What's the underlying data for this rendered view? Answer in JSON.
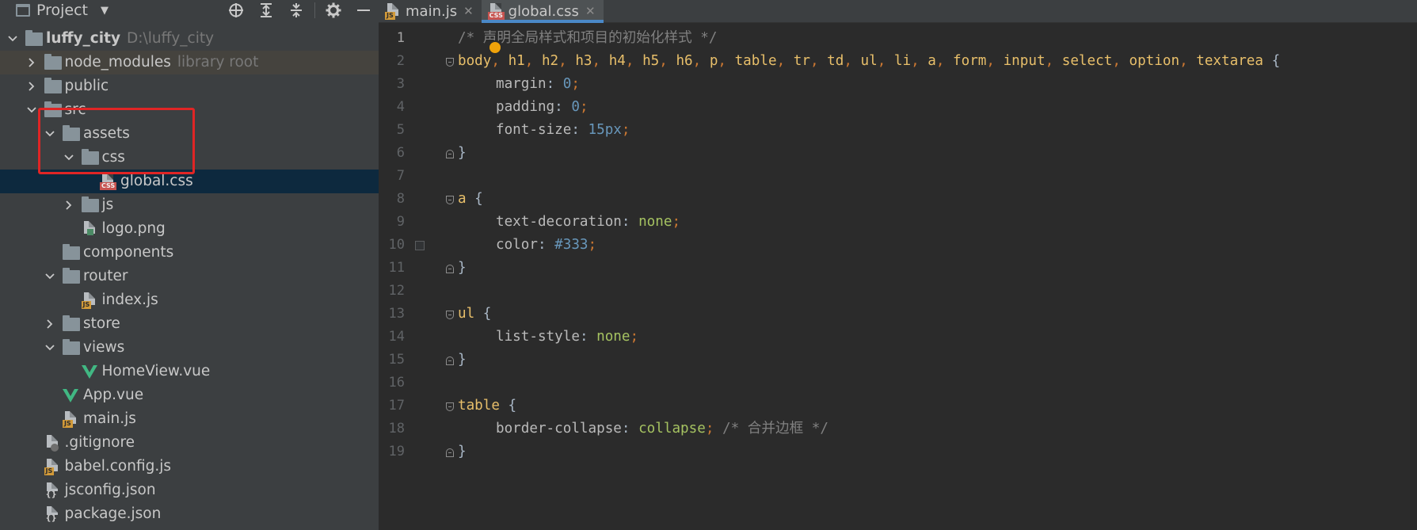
{
  "project": {
    "title": "Project",
    "tree": [
      {
        "label": "luffy_city",
        "hint": "D:\\luffy_city",
        "type": "folder",
        "depth": 0,
        "expanded": true,
        "bold": true
      },
      {
        "label": "node_modules",
        "hint": "library root",
        "type": "folder",
        "depth": 1,
        "expanded": false
      },
      {
        "label": "public",
        "type": "folder",
        "depth": 1,
        "expanded": false
      },
      {
        "label": "src",
        "type": "folder",
        "depth": 1,
        "expanded": true
      },
      {
        "label": "assets",
        "type": "folder",
        "depth": 2,
        "expanded": true
      },
      {
        "label": "css",
        "type": "folder",
        "depth": 3,
        "expanded": true
      },
      {
        "label": "global.css",
        "type": "css",
        "depth": 4,
        "selected": true
      },
      {
        "label": "js",
        "type": "folder",
        "depth": 3,
        "expanded": false
      },
      {
        "label": "logo.png",
        "type": "png",
        "depth": 3
      },
      {
        "label": "components",
        "type": "folder",
        "depth": 2
      },
      {
        "label": "router",
        "type": "folder",
        "depth": 2,
        "expanded": true
      },
      {
        "label": "index.js",
        "type": "js",
        "depth": 3
      },
      {
        "label": "store",
        "type": "folder",
        "depth": 2,
        "expanded": false
      },
      {
        "label": "views",
        "type": "folder",
        "depth": 2,
        "expanded": true
      },
      {
        "label": "HomeView.vue",
        "type": "vue",
        "depth": 3
      },
      {
        "label": "App.vue",
        "type": "vue",
        "depth": 2
      },
      {
        "label": "main.js",
        "type": "js",
        "depth": 2
      },
      {
        "label": ".gitignore",
        "type": "git",
        "depth": 1
      },
      {
        "label": "babel.config.js",
        "type": "js",
        "depth": 1
      },
      {
        "label": "jsconfig.json",
        "type": "json",
        "depth": 1
      },
      {
        "label": "package.json",
        "type": "json",
        "depth": 1
      }
    ]
  },
  "tabs": [
    {
      "label": "main.js",
      "type": "js",
      "active": false
    },
    {
      "label": "global.css",
      "type": "css",
      "active": true
    }
  ],
  "editor": {
    "lines": [
      [
        [
          "c-comment",
          "/* 声明全局样式和项目的初始化样式 */"
        ]
      ],
      [
        [
          "c-sel",
          "body"
        ],
        [
          "c-punc",
          ", "
        ],
        [
          "c-sel",
          "h1"
        ],
        [
          "c-punc",
          ", "
        ],
        [
          "c-sel",
          "h2"
        ],
        [
          "c-punc",
          ", "
        ],
        [
          "c-sel",
          "h3"
        ],
        [
          "c-punc",
          ", "
        ],
        [
          "c-sel",
          "h4"
        ],
        [
          "c-punc",
          ", "
        ],
        [
          "c-sel",
          "h5"
        ],
        [
          "c-punc",
          ", "
        ],
        [
          "c-sel",
          "h6"
        ],
        [
          "c-punc",
          ", "
        ],
        [
          "c-sel",
          "p"
        ],
        [
          "c-punc",
          ", "
        ],
        [
          "c-sel",
          "table"
        ],
        [
          "c-punc",
          ", "
        ],
        [
          "c-sel",
          "tr"
        ],
        [
          "c-punc",
          ", "
        ],
        [
          "c-sel",
          "td"
        ],
        [
          "c-punc",
          ", "
        ],
        [
          "c-sel",
          "ul"
        ],
        [
          "c-punc",
          ", "
        ],
        [
          "c-sel",
          "li"
        ],
        [
          "c-punc",
          ", "
        ],
        [
          "c-sel",
          "a"
        ],
        [
          "c-punc",
          ", "
        ],
        [
          "c-sel",
          "form"
        ],
        [
          "c-punc",
          ", "
        ],
        [
          "c-sel",
          "input"
        ],
        [
          "c-punc",
          ", "
        ],
        [
          "c-sel",
          "select"
        ],
        [
          "c-punc",
          ", "
        ],
        [
          "c-sel",
          "option"
        ],
        [
          "c-punc",
          ", "
        ],
        [
          "c-sel",
          "textarea"
        ],
        [
          "c-brace",
          " {"
        ]
      ],
      [
        [
          "c-prop",
          "margin"
        ],
        [
          "c-brace",
          ": "
        ],
        [
          "c-num",
          "0"
        ],
        [
          "c-punc",
          ";"
        ]
      ],
      [
        [
          "c-prop",
          "padding"
        ],
        [
          "c-brace",
          ": "
        ],
        [
          "c-num",
          "0"
        ],
        [
          "c-punc",
          ";"
        ]
      ],
      [
        [
          "c-prop",
          "font-size"
        ],
        [
          "c-brace",
          ": "
        ],
        [
          "c-num",
          "15px"
        ],
        [
          "c-punc",
          ";"
        ]
      ],
      [
        [
          "c-brace",
          "}"
        ]
      ],
      [],
      [
        [
          "c-sel",
          "a"
        ],
        [
          "c-brace",
          " {"
        ]
      ],
      [
        [
          "c-prop",
          "text-decoration"
        ],
        [
          "c-brace",
          ": "
        ],
        [
          "c-kw",
          "none"
        ],
        [
          "c-punc",
          ";"
        ]
      ],
      [
        [
          "c-prop",
          "color"
        ],
        [
          "c-brace",
          ": "
        ],
        [
          "c-hex",
          "#333"
        ],
        [
          "c-punc",
          ";"
        ]
      ],
      [
        [
          "c-brace",
          "}"
        ]
      ],
      [],
      [
        [
          "c-sel",
          "ul"
        ],
        [
          "c-brace",
          " {"
        ]
      ],
      [
        [
          "c-prop",
          "list-style"
        ],
        [
          "c-brace",
          ": "
        ],
        [
          "c-kw",
          "none"
        ],
        [
          "c-punc",
          ";"
        ]
      ],
      [
        [
          "c-brace",
          "}"
        ]
      ],
      [],
      [
        [
          "c-sel",
          "table"
        ],
        [
          "c-brace",
          " {"
        ]
      ],
      [
        [
          "c-prop",
          "border-collapse"
        ],
        [
          "c-brace",
          ": "
        ],
        [
          "c-kw",
          "collapse"
        ],
        [
          "c-punc",
          "; "
        ],
        [
          "c-comment",
          "/* 合并边框 */"
        ]
      ],
      [
        [
          "c-brace",
          "}"
        ]
      ]
    ],
    "line_numbers": [
      "1",
      "2",
      "3",
      "4",
      "5",
      "6",
      "7",
      "8",
      "9",
      "10",
      "11",
      "12",
      "13",
      "14",
      "15",
      "16",
      "17",
      "18",
      "19"
    ]
  },
  "colors": {
    "selection": "#0d293e",
    "highlight_box": "#e02525",
    "active_tab_underline": "#4a88c7",
    "vue_green": "#41b883"
  }
}
